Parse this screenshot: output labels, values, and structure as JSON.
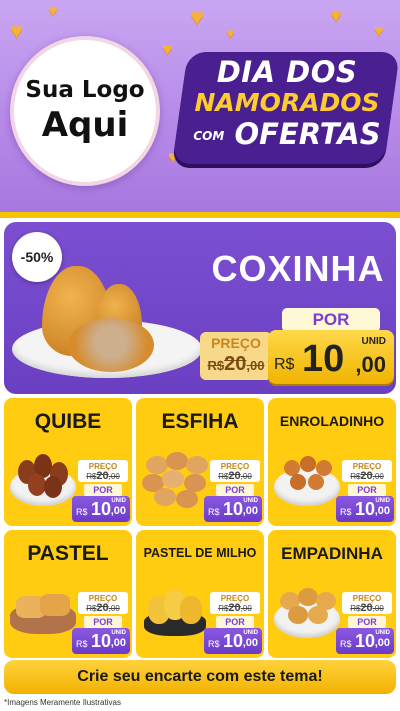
{
  "header": {
    "logo_line1": "Sua Logo",
    "logo_line2": "Aqui",
    "title_line1": "DIA DOS",
    "title_line2": "NAMORADOS",
    "title_com": "COM",
    "title_line3": "OFERTAS"
  },
  "featured": {
    "discount": "-50%",
    "name": "COXINHA",
    "preco_label": "PREÇO",
    "old_currency": "R$",
    "old_int": "20",
    "old_dec": ",00",
    "por_label": "POR",
    "unid_label": "UNID",
    "currency": "R$",
    "price_int": "10",
    "price_dec": ",00"
  },
  "products": [
    {
      "name": "QUIBE",
      "preco_label": "PREÇO",
      "old_currency": "R$",
      "old_int": "20",
      "old_dec": ",00",
      "por_label": "POR",
      "unid_label": "UNID",
      "currency": "R$",
      "price_int": "10",
      "price_dec": ",00"
    },
    {
      "name": "ESFIHA",
      "preco_label": "PREÇO",
      "old_currency": "R$",
      "old_int": "20",
      "old_dec": ",00",
      "por_label": "POR",
      "unid_label": "UNID",
      "currency": "R$",
      "price_int": "10",
      "price_dec": ",00"
    },
    {
      "name": "ENROLADINHO",
      "preco_label": "PREÇO",
      "old_currency": "R$",
      "old_int": "20",
      "old_dec": ",00",
      "por_label": "POR",
      "unid_label": "UNID",
      "currency": "R$",
      "price_int": "10",
      "price_dec": ",00"
    },
    {
      "name": "PASTEL",
      "preco_label": "PREÇO",
      "old_currency": "R$",
      "old_int": "20",
      "old_dec": ",00",
      "por_label": "POR",
      "unid_label": "UNID",
      "currency": "R$",
      "price_int": "10",
      "price_dec": ",00"
    },
    {
      "name": "PASTEL DE MILHO",
      "preco_label": "PREÇO",
      "old_currency": "R$",
      "old_int": "20",
      "old_dec": ",00",
      "por_label": "POR",
      "unid_label": "UNID",
      "currency": "R$",
      "price_int": "10",
      "price_dec": ",00"
    },
    {
      "name": "EMPADINHA",
      "preco_label": "PREÇO",
      "old_currency": "R$",
      "old_int": "20",
      "old_dec": ",00",
      "por_label": "POR",
      "unid_label": "UNID",
      "currency": "R$",
      "price_int": "10",
      "price_dec": ",00"
    }
  ],
  "footer": {
    "cta": "Crie seu encarte com este tema!",
    "disclaimer": "*Imagens Meramente Ilustrativas"
  },
  "colors": {
    "header_purple": "#b78be9",
    "badge_purple": "#4a1f8f",
    "card_yellow": "#ffcc12",
    "price_purple": "#6b3bc8",
    "accent_gold": "#f4c400"
  }
}
